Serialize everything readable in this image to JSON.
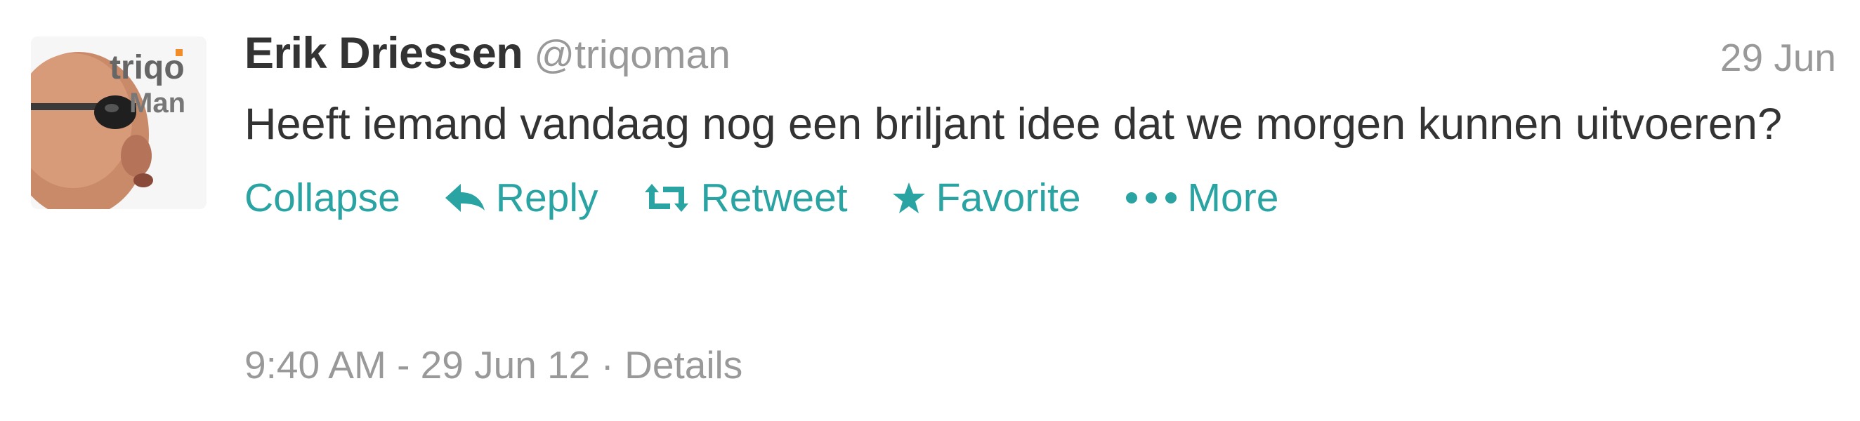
{
  "tweet": {
    "fullname": "Erik Driessen",
    "username": "@triqoman",
    "time": "29 Jun",
    "text": "Heeft iemand vandaag nog een briljant idee dat we morgen kunnen uitvoeren?",
    "avatar": {
      "logo_text_1": "triqo",
      "logo_text_2": "Man"
    }
  },
  "actions": {
    "collapse": "Collapse",
    "reply": "Reply",
    "retweet": "Retweet",
    "favorite": "Favorite",
    "more": "More"
  },
  "meta": {
    "timestamp": "9:40 AM - 29 Jun 12",
    "separator": " · ",
    "details": "Details"
  },
  "colors": {
    "link": "#2aa3a3",
    "muted": "#999999",
    "text": "#333333"
  }
}
